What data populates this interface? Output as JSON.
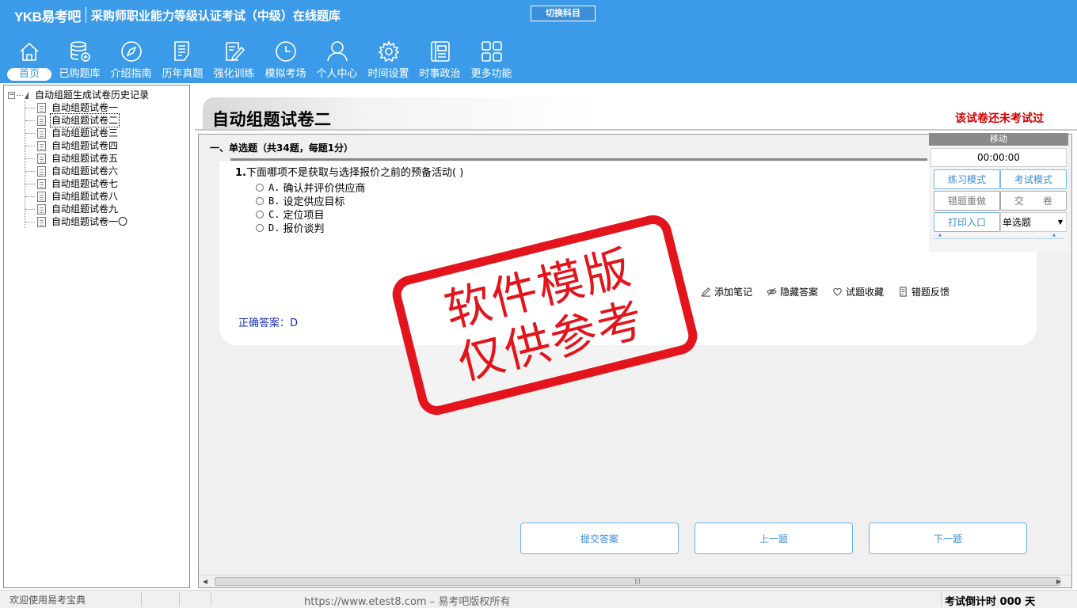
{
  "header": {
    "brand": "YKB易考吧",
    "subtitle": "采购师职业能力等级认证考试（中级）在线题库",
    "switch_label": "切换科目",
    "nav": [
      {
        "label": "首页",
        "icon": "home-icon"
      },
      {
        "label": "已购题库",
        "icon": "database-icon"
      },
      {
        "label": "介绍指南",
        "icon": "compass-icon"
      },
      {
        "label": "历年真题",
        "icon": "list-icon"
      },
      {
        "label": "强化训练",
        "icon": "edit-icon"
      },
      {
        "label": "模拟考场",
        "icon": "clock-icon"
      },
      {
        "label": "个人中心",
        "icon": "user-icon"
      },
      {
        "label": "时间设置",
        "icon": "gear-icon"
      },
      {
        "label": "时事政治",
        "icon": "news-icon"
      },
      {
        "label": "更多功能",
        "icon": "grid-icon"
      }
    ]
  },
  "tree": {
    "root": "自动组题生成试卷历史记录",
    "items": [
      "自动组题试卷一",
      "自动组题试卷二",
      "自动组题试卷三",
      "自动组题试卷四",
      "自动组题试卷五",
      "自动组题试卷六",
      "自动组题试卷七",
      "自动组题试卷八",
      "自动组题试卷九",
      "自动组题试卷一〇"
    ],
    "selected_index": 1
  },
  "paper": {
    "title": "自动组题试卷二",
    "status": "该试卷还未考试过",
    "section_title": "一、单选题（共34题，每题1分）"
  },
  "question": {
    "number": "1.",
    "stem": "下面哪项不是获取与选择报价之前的预备活动( )",
    "options": [
      {
        "letter": "A.",
        "text": "确认并评价供应商"
      },
      {
        "letter": "B.",
        "text": "设定供应目标"
      },
      {
        "letter": "C.",
        "text": "定位项目"
      },
      {
        "letter": "D.",
        "text": "报价谈判"
      }
    ],
    "tools": [
      "添加笔记",
      "隐藏答案",
      "试题收藏",
      "错题反馈"
    ],
    "answer_label": "正确答案：",
    "answer_value": "D"
  },
  "actions": {
    "submit": "提交答案",
    "prev": "上一题",
    "next": "下一题"
  },
  "side_panel": {
    "move": "移动",
    "timer": "00:00:00",
    "practice_mode": "练习模式",
    "exam_mode": "考试模式",
    "redo_wrong": "错题重做",
    "hand_in": "交　　卷",
    "print_entry": "打印入口",
    "type_value": "单选题"
  },
  "watermark": {
    "line1": "软件模版",
    "line2": "仅供参考"
  },
  "statusbar": {
    "welcome": "欢迎使用易考宝典",
    "copyright": "https://www.etest8.com – 易考吧版权所有",
    "countdown": "考试倒计时 000 天"
  },
  "colors": {
    "header_bg": "#3c9be8",
    "status_red": "#d40000",
    "answer_blue": "#1c2fb4",
    "stamp_red": "#e3141c"
  }
}
